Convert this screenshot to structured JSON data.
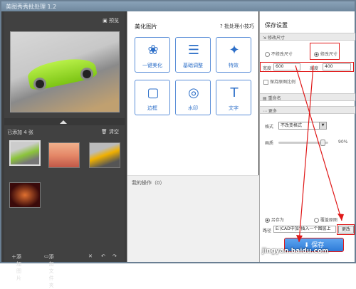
{
  "titlebar": {
    "title": "美图秀秀批处理 1.2"
  },
  "left": {
    "preview_label": "预览",
    "added_label": "已添加 4 张",
    "clear_label": "清空",
    "bottom": {
      "add_photo": "添加图片",
      "add_folder": "添加文件夹"
    }
  },
  "center": {
    "title": "美化图片",
    "tips": "批处理小技巧",
    "tools": [
      {
        "label": "一键美化",
        "icon": "tulip-icon"
      },
      {
        "label": "基础调整",
        "icon": "sliders-icon"
      },
      {
        "label": "特效",
        "icon": "magic-wand-icon"
      },
      {
        "label": "边框",
        "icon": "frame-icon"
      },
      {
        "label": "水印",
        "icon": "watermark-icon"
      },
      {
        "label": "文字",
        "icon": "text-icon"
      }
    ],
    "ops_label": "我的操作（0）"
  },
  "right": {
    "title": "保存设置",
    "resize_header": "修改尺寸",
    "no_resize": "不修改尺寸",
    "resize": "修改尺寸",
    "width_label": "宽度",
    "width_value": "600",
    "height_label": "高度",
    "height_value": "400",
    "keep_ratio": "保持原图比例",
    "rename_header": "重命名",
    "more_header": "更多",
    "format_label": "格式",
    "format_value": "不改变格式",
    "quality_label": "画质",
    "quality_value": "90%",
    "quality_level": 0.9,
    "save_as": "另存为",
    "overwrite": "覆盖原图",
    "path_label": "路径",
    "path_value": "E:\\CAD中加\"插入一个图层上",
    "change_button": "更改",
    "save_button": "保存"
  },
  "watermark": "jingyan.baidu.com",
  "colors": {
    "accent": "#2d6fc8",
    "highlight": "#e01818"
  }
}
